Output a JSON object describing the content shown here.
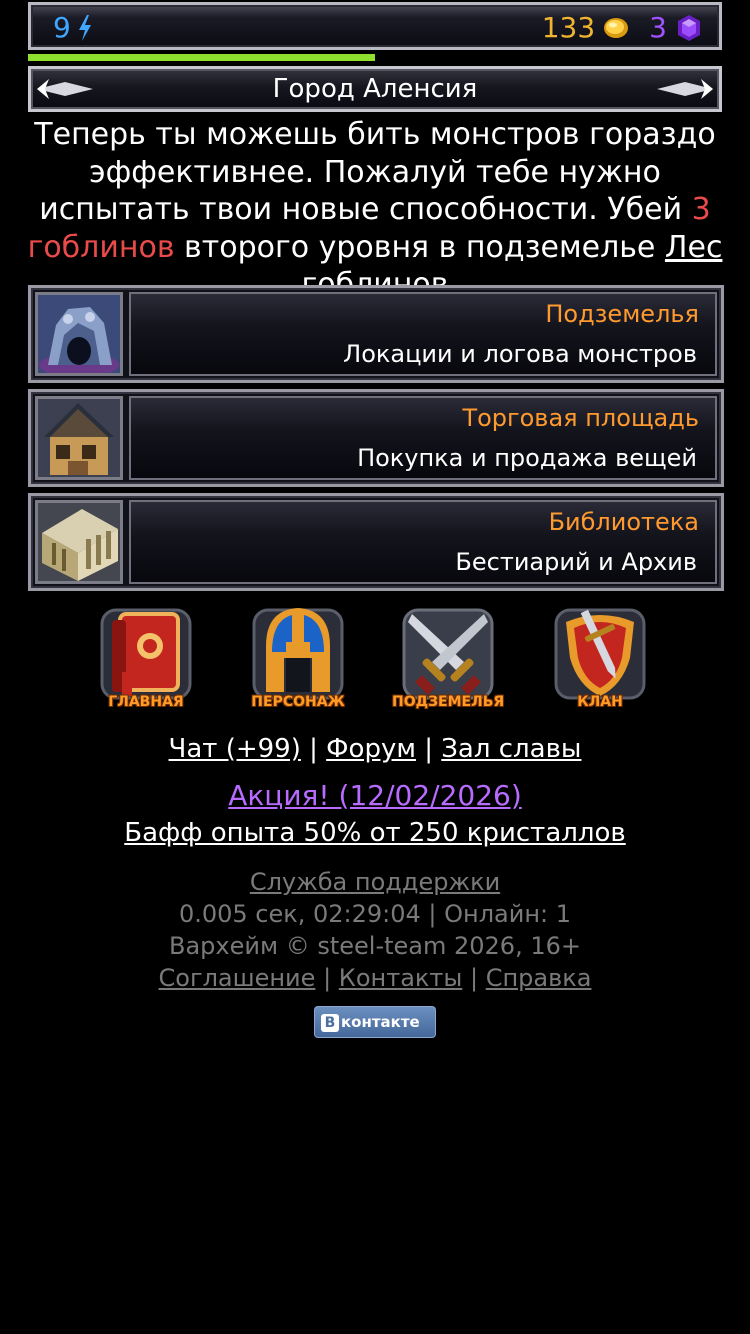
{
  "status": {
    "energy": "9",
    "gold": "133",
    "crystals": "3",
    "xp_fraction": 0.5,
    "icons": [
      "lightning-icon",
      "gold-coin-icon",
      "crystal-icon"
    ]
  },
  "location": {
    "title": "Город Аленсия"
  },
  "quest": {
    "text_before": "Теперь ты можешь бить монстров гораздо эффективнее. Пожалуй тебе нужно испытать твои новые способности. Убей ",
    "highlight": "3 гоблинов",
    "text_middle": " второго уровня в подземелье ",
    "link": "Лес гоблинов"
  },
  "menu": [
    {
      "title": "Подземелья",
      "subtitle": "Локации и логова монстров",
      "icon": "dungeon-icon"
    },
    {
      "title": "Торговая площадь",
      "subtitle": "Покупка и продажа вещей",
      "icon": "market-icon"
    },
    {
      "title": "Библиотека",
      "subtitle": "Бестиарий и Архив",
      "icon": "library-icon"
    }
  ],
  "nav": [
    {
      "label": "ГЛАВНАЯ",
      "icon": "book-icon"
    },
    {
      "label": "ПЕРСОНАЖ",
      "icon": "helmet-icon"
    },
    {
      "label": "ПОДЗЕМЕЛЬЯ",
      "icon": "crossed-swords-icon"
    },
    {
      "label": "КЛАН",
      "icon": "shield-sword-icon"
    }
  ],
  "links": {
    "chat": "Чат (+99)",
    "forum": "Форум",
    "hall": "Зал славы",
    "separator": "|"
  },
  "promo": {
    "label": "Акция! (12/02/2026)",
    "buff": "Бафф опыта 50% от 250 кристаллов"
  },
  "footer": {
    "support": "Служба поддержки",
    "stats": "0.005 сек, 02:29:04 | Онлайн: 1",
    "copyright": "Вархейм © steel-team 2026, 16+",
    "agreement": "Соглашение",
    "contacts": "Контакты",
    "help": "Справка"
  },
  "vk": {
    "badge": "В",
    "label": "контакте"
  },
  "colors": {
    "energy": "#3fa7ff",
    "gold": "#f0b430",
    "crystal": "#a052ff",
    "xp": "#8fe02e",
    "menu_title": "#ff9a2e",
    "quest_highlight": "#e94b4b",
    "promo": "#b86bff"
  }
}
